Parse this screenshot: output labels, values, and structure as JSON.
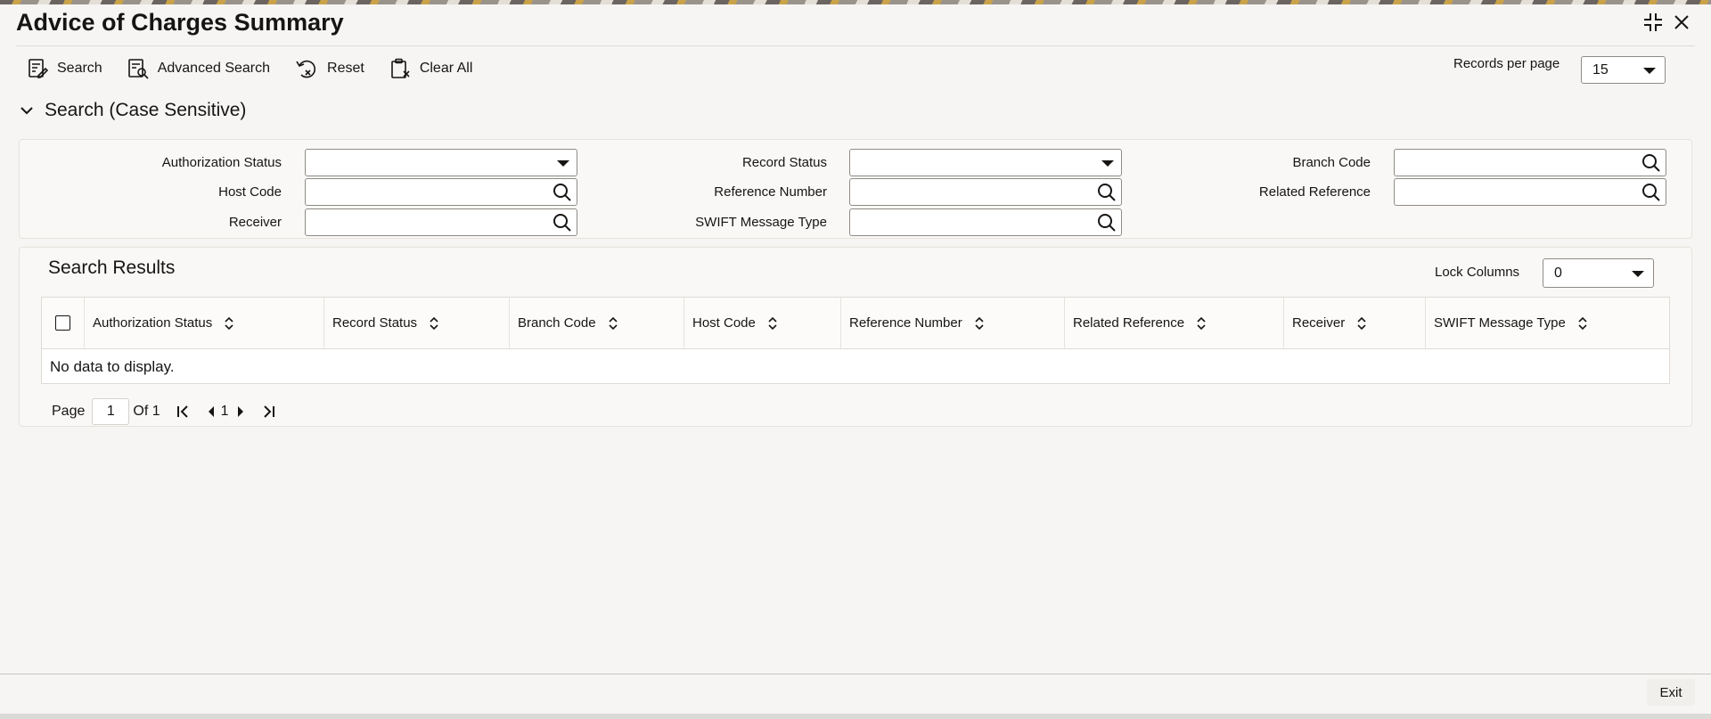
{
  "window": {
    "title": "Advice of Charges Summary"
  },
  "toolbar": {
    "search": "Search",
    "advanced_search": "Advanced Search",
    "reset": "Reset",
    "clear_all": "Clear All"
  },
  "records_per_page": {
    "label": "Records per page",
    "value": "15"
  },
  "search_section": {
    "title": "Search (Case Sensitive)",
    "fields": {
      "authorization_status": {
        "label": "Authorization Status",
        "value": ""
      },
      "record_status": {
        "label": "Record Status",
        "value": ""
      },
      "branch_code": {
        "label": "Branch Code",
        "value": ""
      },
      "host_code": {
        "label": "Host Code",
        "value": ""
      },
      "reference_number": {
        "label": "Reference Number",
        "value": ""
      },
      "related_reference": {
        "label": "Related Reference",
        "value": ""
      },
      "receiver": {
        "label": "Receiver",
        "value": ""
      },
      "swift_message_type": {
        "label": "SWIFT Message Type",
        "value": ""
      }
    }
  },
  "results": {
    "title": "Search Results",
    "lock_columns": {
      "label": "Lock Columns",
      "value": "0"
    },
    "columns": [
      "Authorization Status",
      "Record Status",
      "Branch Code",
      "Host Code",
      "Reference Number",
      "Related Reference",
      "Receiver",
      "SWIFT Message Type"
    ],
    "empty_message": "No data to display."
  },
  "pagination": {
    "page_label": "Page",
    "page_value": "1",
    "of_label": "Of 1",
    "current": "1"
  },
  "footer": {
    "exit": "Exit"
  }
}
